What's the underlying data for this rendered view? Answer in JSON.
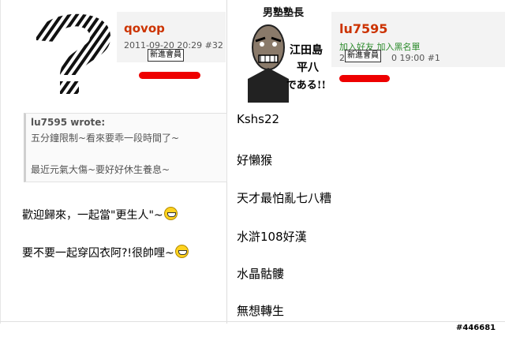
{
  "left_post": {
    "username": "qovop",
    "datetime": "2011-09-20 20:29",
    "post_number": "#32",
    "badge": "新進會員",
    "avatar": "question-mark-icon",
    "quote": {
      "author": "lu7595 wrote:",
      "lines": [
        "五分鐘限制~看來要乖一段時間了~",
        "最近元氣大傷~要好好休生養息~"
      ]
    },
    "messages": [
      "歡迎歸來，一起當\"更生人\"~",
      "要不要一起穿囚衣阿?!很帥哩~"
    ]
  },
  "right_post": {
    "username": "lu7595",
    "links": "加入好友 加入黑名單",
    "datetime_partial": "20",
    "datetime_tail": "0 19:00",
    "post_number": "#1",
    "badge": "新進會員",
    "avatar": "manga-face-avatar",
    "avatar_text": [
      "男塾塾長",
      "江田島",
      "平八",
      "である!!"
    ],
    "lines": [
      "Kshs22",
      "好懶猴",
      "天才最怕亂七八糟",
      "水滸108好漢",
      "水晶骷髏",
      "無想轉生"
    ]
  },
  "post_id": "#446681",
  "colors": {
    "username": "#cc3300",
    "link": "#2a8a2a",
    "underline": "#ee0000",
    "emoji": "#ffd21f"
  }
}
